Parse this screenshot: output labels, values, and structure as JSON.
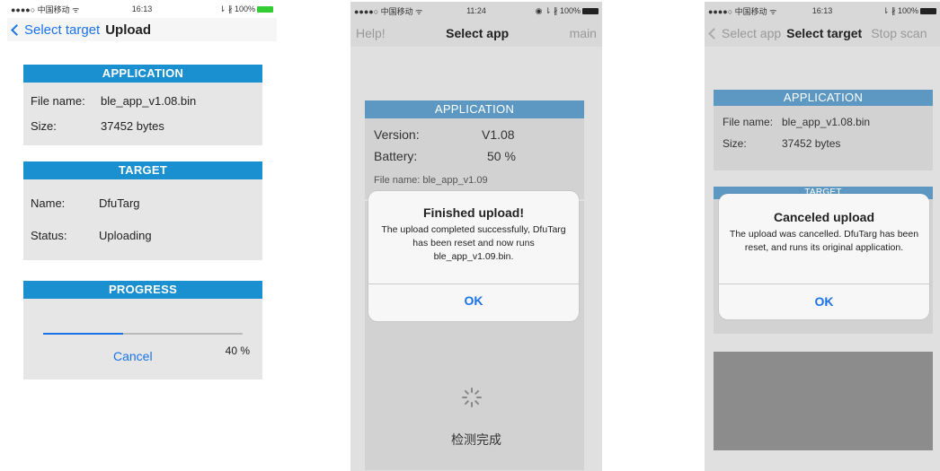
{
  "phone1": {
    "status": {
      "left": "●●●●○ 中国移动 ᯤ",
      "time": "16:13",
      "right": "⇂ ∦ 100%"
    },
    "nav": {
      "back_label": "Select target",
      "title": "Upload"
    },
    "application": {
      "header": "APPLICATION",
      "file_label": "File name:",
      "file_value": "ble_app_v1.08.bin",
      "size_label": "Size:",
      "size_value": "37452 bytes"
    },
    "target": {
      "header": "TARGET",
      "name_label": "Name:",
      "name_value": "DfuTarg",
      "status_label": "Status:",
      "status_value": "Uploading"
    },
    "progress": {
      "header": "PROGRESS",
      "fraction": 0.4,
      "cancel_label": "Cancel",
      "percent_label": "40 %"
    }
  },
  "phone2": {
    "status": {
      "left": "●●●●○ 中国移动 ᯤ",
      "time": "11:24",
      "right": "◉ ⇂ ∦ 100%"
    },
    "nav": {
      "left": "Help!",
      "title": "Select app",
      "right": "main"
    },
    "application": {
      "header": "APPLICATION",
      "version_label": "Version:",
      "version_value": "V1.08",
      "battery_label": "Battery:",
      "battery_value": "50 %",
      "file_partial": "File name:  ble_app_v1.09"
    },
    "alert": {
      "title": "Finished upload!",
      "message": "The upload completed successfully, DfuTarg has been reset and now runs ble_app_v1.09.bin.",
      "ok_label": "OK"
    },
    "footer_status": "检测完成"
  },
  "phone3": {
    "status": {
      "left": "●●●●○ 中国移动 ᯤ",
      "time": "16:13",
      "right": "⇂ ∦ 100%"
    },
    "nav": {
      "back_label": "Select app",
      "title": "Select target",
      "right": "Stop scan"
    },
    "application": {
      "header": "APPLICATION",
      "file_label": "File name:",
      "file_value": "ble_app_v1.08.bin",
      "size_label": "Size:",
      "size_value": "37452 bytes"
    },
    "target_header": "TARGET",
    "alert": {
      "title": "Canceled upload",
      "message": "The upload was cancelled. DfuTarg has been reset, and runs its original application.",
      "ok_label": "OK"
    }
  },
  "colors": {
    "accent": "#1a73e8",
    "section_header": "#1a90d0"
  }
}
